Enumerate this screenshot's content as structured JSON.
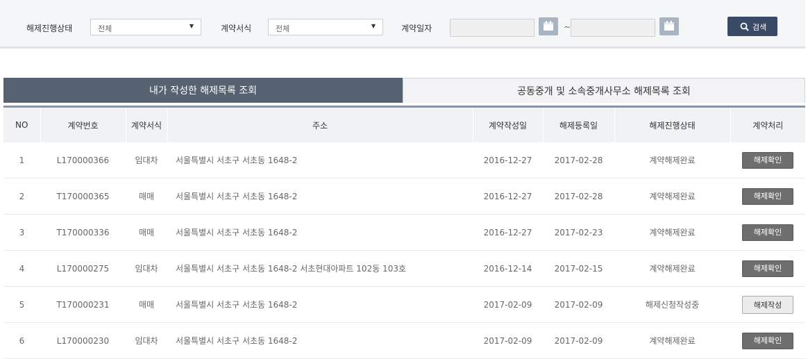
{
  "search": {
    "status_label": "해제진행상태",
    "status_value": "전체",
    "form_label": "계약서식",
    "form_value": "전체",
    "date_label": "계약일자",
    "date_from": "",
    "date_to": "",
    "date_separator": "~",
    "search_button": "검색"
  },
  "tabs": [
    {
      "label": "내가 작성한 해제목록 조회",
      "active": true
    },
    {
      "label": "공동중개 및 소속중개사무소 해제목록 조회",
      "active": false
    }
  ],
  "table": {
    "headers": [
      "NO",
      "계약번호",
      "계약서식",
      "주소",
      "계약작성일",
      "해제등록일",
      "해제진행상태",
      "계약처리"
    ],
    "rows": [
      {
        "no": "1",
        "contract_no": "L170000366",
        "form": "임대차",
        "address": "서울특별시 서초구 서초동 1648-2",
        "written": "2016-12-27",
        "cancelled": "2017-02-28",
        "status": "계약해제완료",
        "action": "해제확인",
        "action_type": "confirm"
      },
      {
        "no": "2",
        "contract_no": "T170000365",
        "form": "매매",
        "address": "서울특별시 서초구 서초동 1648-2",
        "written": "2016-12-27",
        "cancelled": "2017-02-28",
        "status": "계약해제완료",
        "action": "해제확인",
        "action_type": "confirm"
      },
      {
        "no": "3",
        "contract_no": "T170000336",
        "form": "매매",
        "address": "서울특별시 서초구 서초동 1648-2",
        "written": "2016-12-27",
        "cancelled": "2017-02-23",
        "status": "계약해제완료",
        "action": "해제확인",
        "action_type": "confirm"
      },
      {
        "no": "4",
        "contract_no": "L170000275",
        "form": "임대차",
        "address": "서울특별시 서초구 서초동 1648-2 서초현대아파트 102동 103호",
        "written": "2016-12-14",
        "cancelled": "2017-02-15",
        "status": "계약해제완료",
        "action": "해제확인",
        "action_type": "confirm"
      },
      {
        "no": "5",
        "contract_no": "T170000231",
        "form": "매매",
        "address": "서울특별시 서초구 서초동 1648-2",
        "written": "2017-02-09",
        "cancelled": "2017-02-09",
        "status": "해제신청작성중",
        "action": "해제작성",
        "action_type": "write"
      },
      {
        "no": "6",
        "contract_no": "L170000230",
        "form": "임대차",
        "address": "서울특별시 서초구 서초동 1648-2",
        "written": "2017-02-09",
        "cancelled": "2017-02-09",
        "status": "계약해제완료",
        "action": "해제확인",
        "action_type": "confirm"
      }
    ]
  },
  "colors": {
    "primary_navy": "#384a66",
    "tab_active": "#566272",
    "button_confirm": "#6e6e6e",
    "header_bg": "#f1f2f4"
  },
  "icons": {
    "calendar": "calendar-icon",
    "search": "search-icon"
  }
}
